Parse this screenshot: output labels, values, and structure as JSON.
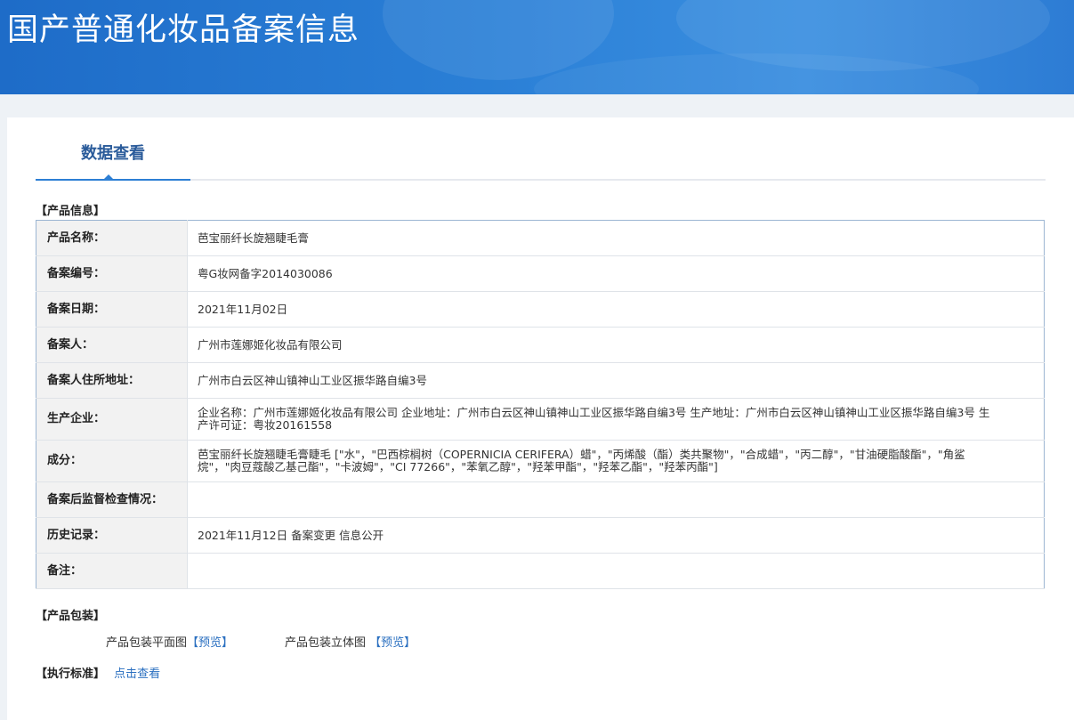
{
  "header": {
    "title": "国产普通化妆品备案信息"
  },
  "tab": {
    "label": "数据查看"
  },
  "product_info": {
    "section_label": "【产品信息】",
    "rows": [
      {
        "label": "产品名称：",
        "value": "芭宝丽纤长旋翘睫毛膏"
      },
      {
        "label": "备案编号：",
        "value": "粤G妆网备字2014030086"
      },
      {
        "label": "备案日期：",
        "value": "2021年11月02日"
      },
      {
        "label": "备案人：",
        "value": "广州市莲娜姬化妆品有限公司"
      },
      {
        "label": "备案人住所地址：",
        "value": "广州市白云区神山镇神山工业区振华路自编3号"
      },
      {
        "label": "生产企业：",
        "value": "企业名称：广州市莲娜姬化妆品有限公司 企业地址：广州市白云区神山镇神山工业区振华路自编3号 生产地址：广州市白云区神山镇神山工业区振华路自编3号 生产许可证：粤妆20161558"
      },
      {
        "label": "成分：",
        "value": "芭宝丽纤长旋翘睫毛膏睫毛 [\"水\"，\"巴西棕榈树（COPERNICIA CERIFERA）蜡\"，\"丙烯酸（酯）类共聚物\"，\"合成蜡\"，\"丙二醇\"，\"甘油硬脂酸酯\"，\"角鲨烷\"，\"肉豆蔻酸乙基己酯\"，\"卡波姆\"，\"CI 77266\"，\"苯氧乙醇\"，\"羟苯甲酯\"，\"羟苯乙酯\"，\"羟苯丙酯\"]"
      },
      {
        "label": "备案后监督检查情况：",
        "value": ""
      },
      {
        "label": "历史记录：",
        "value": "2021年11月12日 备案变更 信息公开"
      },
      {
        "label": "备注：",
        "value": ""
      }
    ]
  },
  "packaging": {
    "section_label": "【产品包装】",
    "flat_label": "产品包装平面图",
    "flat_link": "【预览】",
    "solid_label": "产品包装立体图",
    "solid_link": "【预览】"
  },
  "standard": {
    "section_label": "【执行标准】",
    "link": "点击查看"
  }
}
